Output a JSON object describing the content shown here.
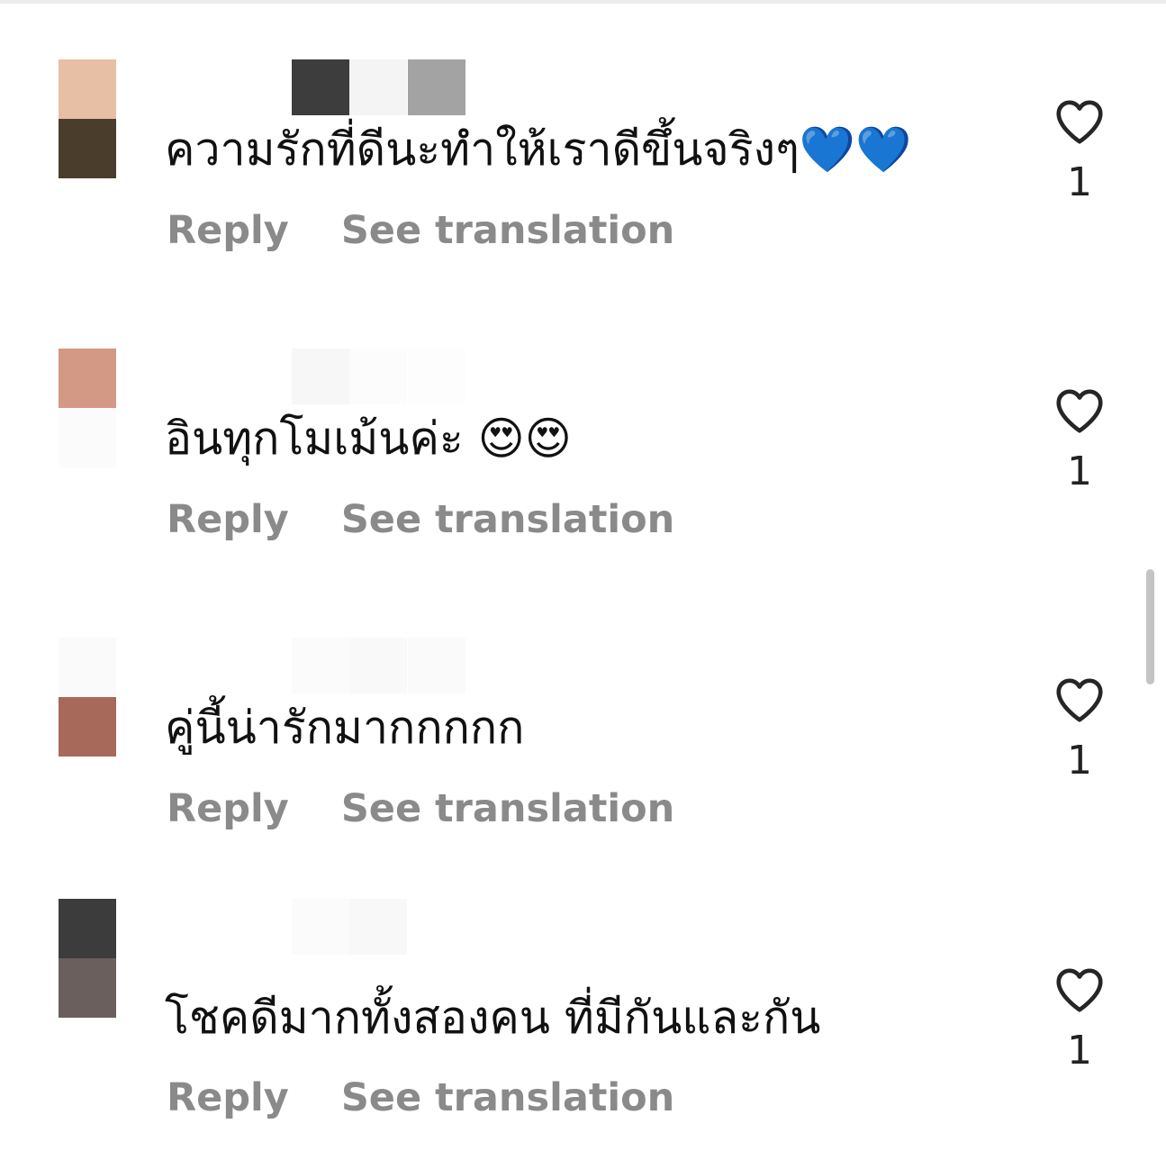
{
  "colors": {
    "action_text": "#8a8a8a",
    "comment_text": "#111111",
    "heart_outline": "#262626",
    "scrollbar": "#c4c4c4"
  },
  "comments": [
    {
      "text": "ความรักที่ดีนะทำให้เราดีขึ้นจริงๆ💙💙",
      "reply_label": "Reply",
      "translate_label": "See translation",
      "like_count": "1",
      "like_icon": "heart-outline-icon",
      "avatar_colors": [
        "#e6bfa4",
        "#4b3d2c"
      ],
      "username_colors": [
        "#3d3d3d",
        "#f4f4f4",
        "#a3a3a3"
      ]
    },
    {
      "text": "อินทุกโมเม้นค่ะ 😍😍",
      "reply_label": "Reply",
      "translate_label": "See translation",
      "like_count": "1",
      "like_icon": "heart-outline-icon",
      "avatar_colors": [
        "#d49985",
        "#fbfbfb"
      ],
      "username_colors": [
        "#f7f7f7",
        "#fcfcfc",
        "#fdfdfd"
      ]
    },
    {
      "text": "คู่นี้น่ารักมากกกกก",
      "reply_label": "Reply",
      "translate_label": "See translation",
      "like_count": "1",
      "like_icon": "heart-outline-icon",
      "avatar_colors": [
        "#fafafa",
        "#a6695a"
      ],
      "username_colors": [
        "#fbfbfb",
        "#f9f9f9",
        "#fafafa"
      ]
    },
    {
      "text": "โชคดีมากทั้งสองคน ที่มีกันและกัน",
      "reply_label": "Reply",
      "translate_label": "See translation",
      "like_count": "1",
      "like_icon": "heart-outline-icon",
      "avatar_colors": [
        "#3c3c3c",
        "#6a5f5c"
      ],
      "username_colors": [
        "#fbfbfb",
        "#f8f8f8",
        "#ffffff"
      ]
    }
  ]
}
